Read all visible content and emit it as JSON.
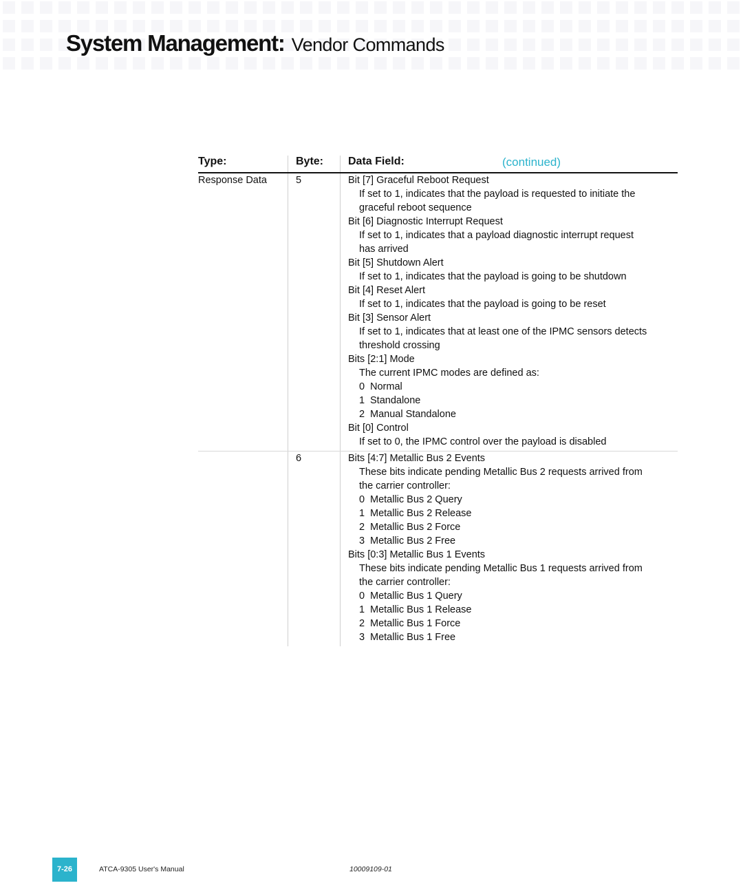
{
  "header": {
    "title_main": "System Management:",
    "title_sub": "Vendor Commands"
  },
  "table": {
    "columns": [
      "Type:",
      "Byte:",
      "Data Field:"
    ],
    "continued_label": "(continued)",
    "rows": [
      {
        "type": "Response Data",
        "byte": "5",
        "fields": [
          {
            "level": 0,
            "text": "Bit [7] Graceful Reboot Request"
          },
          {
            "level": 1,
            "text": "If set to 1, indicates that the payload is requested to initiate the"
          },
          {
            "level": 1,
            "text": "graceful reboot sequence"
          },
          {
            "level": 0,
            "text": "Bit [6] Diagnostic Interrupt Request"
          },
          {
            "level": 1,
            "text": "If set to 1, indicates that a payload diagnostic interrupt request"
          },
          {
            "level": 1,
            "text": "has arrived"
          },
          {
            "level": 0,
            "text": "Bit [5] Shutdown Alert"
          },
          {
            "level": 1,
            "text": "If set to 1, indicates that the payload is going to be shutdown"
          },
          {
            "level": 0,
            "text": "Bit [4] Reset Alert"
          },
          {
            "level": 1,
            "text": "If set to 1, indicates that the payload is going to be reset"
          },
          {
            "level": 0,
            "text": "Bit [3] Sensor Alert"
          },
          {
            "level": 1,
            "text": "If set to 1, indicates that at least one of the IPMC sensors detects"
          },
          {
            "level": 1,
            "text": "threshold crossing"
          },
          {
            "level": 0,
            "text": "Bits [2:1] Mode"
          },
          {
            "level": 1,
            "text": "The current IPMC modes are defined as:"
          },
          {
            "level": 2,
            "num": "0",
            "text": "Normal"
          },
          {
            "level": 2,
            "num": "1",
            "text": "Standalone"
          },
          {
            "level": 2,
            "num": "2",
            "text": "Manual Standalone"
          },
          {
            "level": 0,
            "text": "Bit [0] Control"
          },
          {
            "level": 1,
            "text": "If set to 0, the IPMC control over the payload is disabled"
          }
        ]
      },
      {
        "type": "",
        "byte": "6",
        "fields": [
          {
            "level": 0,
            "text": "Bits [4:7] Metallic Bus 2 Events"
          },
          {
            "level": 1,
            "text": "These bits indicate pending Metallic Bus 2 requests arrived from"
          },
          {
            "level": 1,
            "text": "the carrier controller:"
          },
          {
            "level": 2,
            "num": "0",
            "text": "Metallic Bus 2 Query"
          },
          {
            "level": 2,
            "num": "1",
            "text": "Metallic Bus 2 Release"
          },
          {
            "level": 2,
            "num": "2",
            "text": "Metallic Bus 2 Force"
          },
          {
            "level": 2,
            "num": "3",
            "text": "Metallic Bus 2 Free"
          },
          {
            "level": 0,
            "text": "Bits [0:3] Metallic Bus 1 Events"
          },
          {
            "level": 1,
            "text": "These bits indicate pending Metallic Bus 1 requests arrived from"
          },
          {
            "level": 1,
            "text": "the carrier controller:"
          },
          {
            "level": 2,
            "num": "0",
            "text": "Metallic Bus 1 Query"
          },
          {
            "level": 2,
            "num": "1",
            "text": "Metallic Bus 1 Release"
          },
          {
            "level": 2,
            "num": "2",
            "text": "Metallic Bus 1 Force"
          },
          {
            "level": 2,
            "num": "3",
            "text": "Metallic Bus 1 Free"
          }
        ]
      }
    ]
  },
  "footer": {
    "page_number": "7-26",
    "manual_title": "ATCA-9305 User's Manual",
    "doc_number": "10009109-01"
  },
  "colors": {
    "accent": "#2bb3cc",
    "grid_square": "#f6f6f9"
  }
}
